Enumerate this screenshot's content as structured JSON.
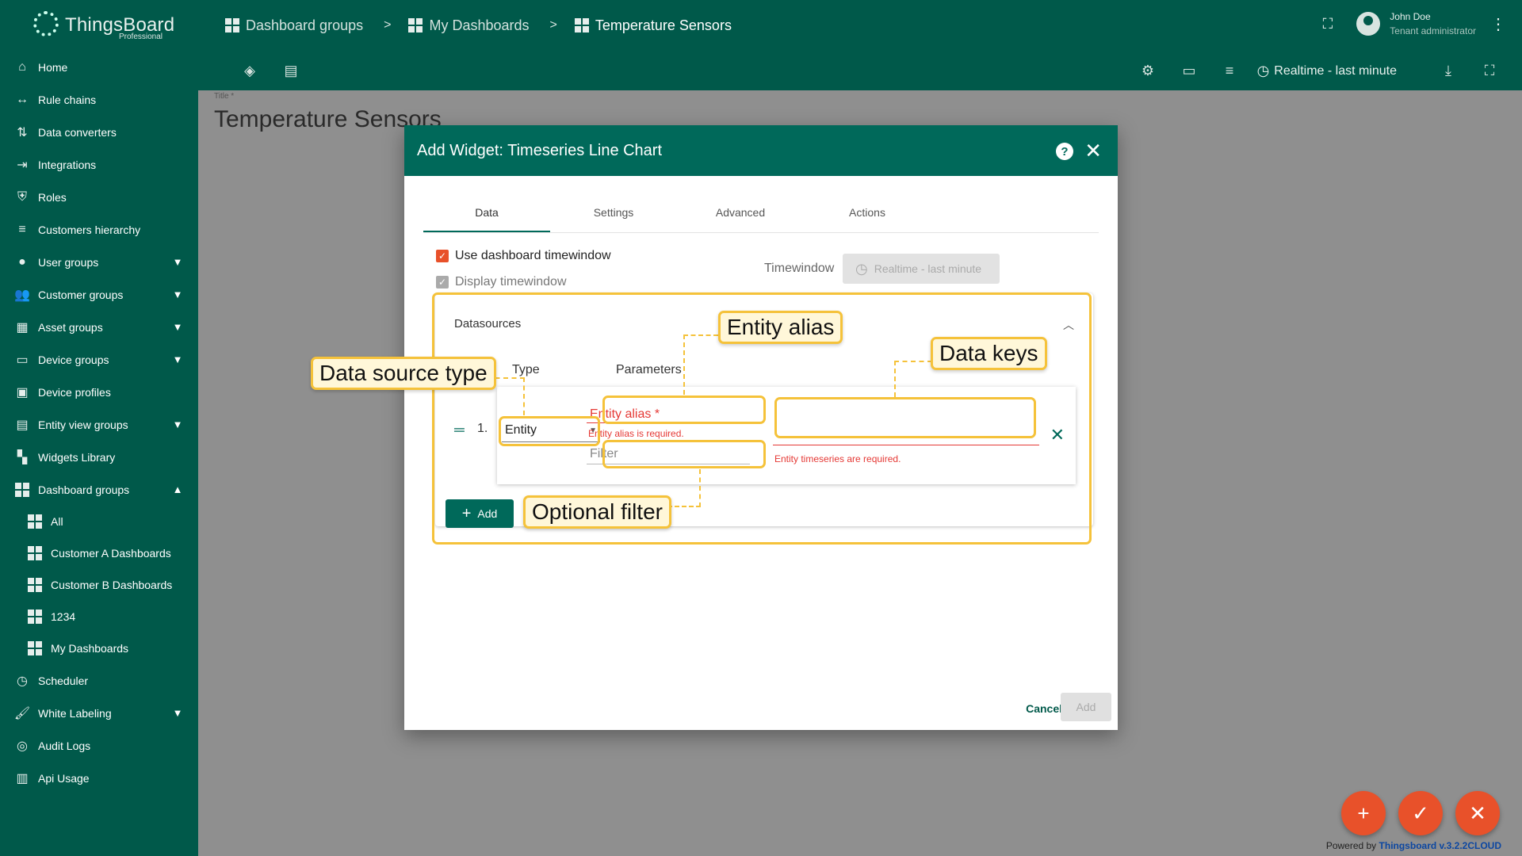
{
  "app": {
    "brand": "ThingsBoard",
    "edition": "Professional"
  },
  "sidebar": {
    "items": [
      {
        "label": "Home",
        "icon": "home-icon"
      },
      {
        "label": "Rule chains",
        "icon": "rule-chain-icon"
      },
      {
        "label": "Data converters",
        "icon": "converter-icon"
      },
      {
        "label": "Integrations",
        "icon": "integration-icon"
      },
      {
        "label": "Roles",
        "icon": "shield-icon"
      },
      {
        "label": "Customers hierarchy",
        "icon": "hierarchy-icon"
      },
      {
        "label": "User groups",
        "icon": "account-icon",
        "expandable": true
      },
      {
        "label": "Customer groups",
        "icon": "people-icon",
        "expandable": true
      },
      {
        "label": "Asset groups",
        "icon": "domain-icon",
        "expandable": true
      },
      {
        "label": "Device groups",
        "icon": "devices-icon",
        "expandable": true
      },
      {
        "label": "Device profiles",
        "icon": "device-profile-icon"
      },
      {
        "label": "Entity view groups",
        "icon": "view-quilt-icon",
        "expandable": true
      },
      {
        "label": "Widgets Library",
        "icon": "widgets-icon"
      },
      {
        "label": "Dashboard groups",
        "icon": "dashboard-icon",
        "expanded": true
      }
    ],
    "sub_items": [
      {
        "label": "All"
      },
      {
        "label": "Customer A Dashboards"
      },
      {
        "label": "Customer B Dashboards"
      },
      {
        "label": "1234"
      },
      {
        "label": "My Dashboards"
      }
    ],
    "bottom_items": [
      {
        "label": "Scheduler",
        "icon": "clock-icon"
      },
      {
        "label": "White Labeling",
        "icon": "format-paint-icon",
        "expandable": true
      },
      {
        "label": "Audit Logs",
        "icon": "track-changes-icon"
      },
      {
        "label": "Api Usage",
        "icon": "insert-chart-icon"
      }
    ]
  },
  "breadcrumb": {
    "items": [
      "Dashboard groups",
      "My Dashboards",
      "Temperature Sensors"
    ],
    "separator": ">"
  },
  "user": {
    "name": "John Doe",
    "role": "Tenant administrator"
  },
  "toolbar": {
    "timewindow_label": "Realtime - last minute"
  },
  "dashboard": {
    "title_label": "Title *",
    "title": "Temperature Sensors"
  },
  "dialog": {
    "title": "Add Widget: Timeseries Line Chart",
    "tabs": [
      "Data",
      "Settings",
      "Advanced",
      "Actions"
    ],
    "active_tab": "Data",
    "use_dashboard_timewindow": "Use dashboard timewindow",
    "display_timewindow": "Display timewindow",
    "timewindow_label": "Timewindow",
    "timewindow_value": "Realtime - last minute",
    "datasources": {
      "title": "Datasources",
      "col_type": "Type",
      "col_params": "Parameters",
      "row_index": "1.",
      "type_value": "Entity",
      "entity_alias_placeholder": "Entity alias *",
      "entity_alias_error": "Entity alias is required.",
      "filter_placeholder": "Filter",
      "timeseries_error": "Entity timeseries are required.",
      "add_label": "Add"
    },
    "cancel_label": "Cancel",
    "add_label": "Add"
  },
  "annotations": {
    "data_source_type": "Data source type",
    "entity_alias": "Entity alias",
    "data_keys": "Data keys",
    "optional_filter": "Optional filter"
  },
  "footer": {
    "powered_prefix": "Powered by",
    "powered_link": "Thingsboard v.3.2.2CLOUD"
  },
  "colors": {
    "primary": "#00594a",
    "dialog_header": "#00695a",
    "error": "#e53935",
    "annotation": "#f5c23a",
    "fab": "#e8512a"
  }
}
